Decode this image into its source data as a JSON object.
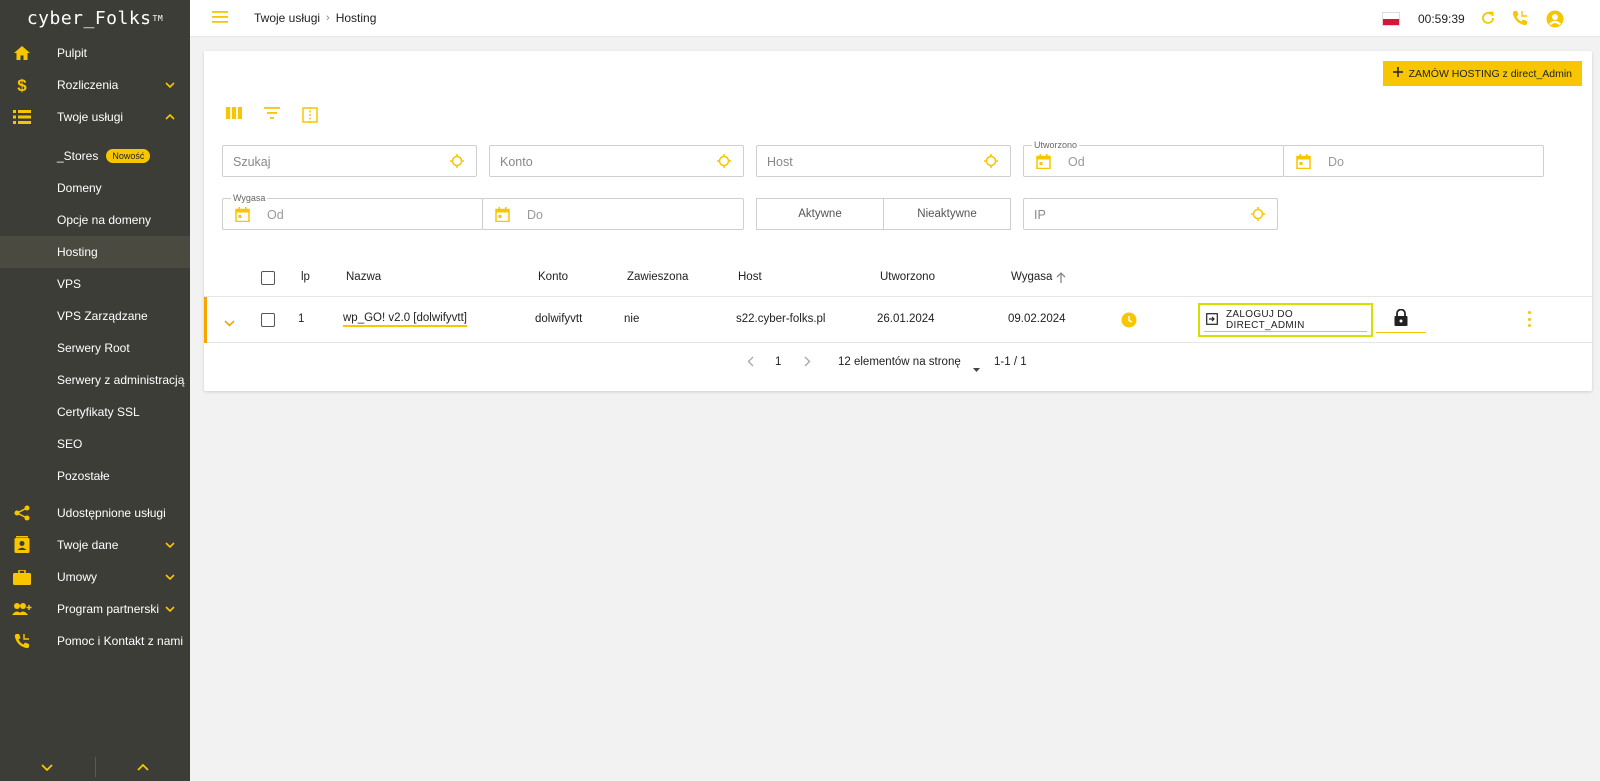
{
  "app": {
    "logo": "cyber_Folks",
    "logo_tm": "TM"
  },
  "sidebar": {
    "items": [
      {
        "label": "Pulpit",
        "icon": "home-icon"
      },
      {
        "label": "Rozliczenia",
        "icon": "dollar-icon"
      },
      {
        "label": "Twoje usługi",
        "icon": "list-icon"
      },
      {
        "label": "_Stores",
        "badge": "Nowość"
      },
      {
        "label": "Domeny"
      },
      {
        "label": "Opcje na domeny"
      },
      {
        "label": "Hosting"
      },
      {
        "label": "VPS"
      },
      {
        "label": "VPS Zarządzane"
      },
      {
        "label": "Serwery Root"
      },
      {
        "label": "Serwery z administracją"
      },
      {
        "label": "Certyfikaty SSL"
      },
      {
        "label": "SEO"
      },
      {
        "label": "Pozostałe"
      },
      {
        "label": "Udostępnione usługi",
        "icon": "share-icon"
      },
      {
        "label": "Twoje dane",
        "icon": "contact-card-icon"
      },
      {
        "label": "Umowy",
        "icon": "briefcase-icon"
      },
      {
        "label": "Program partnerski",
        "icon": "add-user-icon"
      },
      {
        "label": "Pomoc i Kontakt z nami",
        "icon": "phone-icon"
      }
    ],
    "active": "Hosting"
  },
  "topbar": {
    "breadcrumb": [
      "Twoje usługi",
      "Hosting"
    ],
    "timer": "00:59:39"
  },
  "toolbar": {
    "order_label": "ZAMÓW HOSTING z direct_Admin"
  },
  "filters": {
    "search": "Szukaj",
    "konto": "Konto",
    "host": "Host",
    "utworzono_label": "Utworzono",
    "utworzono_od": "Od",
    "utworzono_do": "Do",
    "wygasa_label": "Wygasa",
    "wygasa_od": "Od",
    "wygasa_do": "Do",
    "aktywne": "Aktywne",
    "nieaktywne": "Nieaktywne",
    "ip": "IP"
  },
  "table": {
    "headers": [
      "lp",
      "Nazwa",
      "Konto",
      "Zawieszona",
      "Host",
      "Utworzono",
      "Wygasa"
    ],
    "rows": [
      {
        "lp": "1",
        "nazwa": "wp_GO! v2.0 [dolwifyvtt]",
        "konto": "dolwifyvtt",
        "zawieszona": "nie",
        "host": "s22.cyber-folks.pl",
        "utworzono": "26.01.2024",
        "wygasa": "09.02.2024",
        "login_label": "ZALOGUJ DO DIRECT_ADMIN"
      }
    ]
  },
  "pagination": {
    "page": "1",
    "per_page": "12 elementów na stronę",
    "range": "1-1 / 1"
  },
  "colors": {
    "accent": "#f7c600",
    "sidebar": "#3d3d38",
    "highlight": "#d4e000"
  }
}
